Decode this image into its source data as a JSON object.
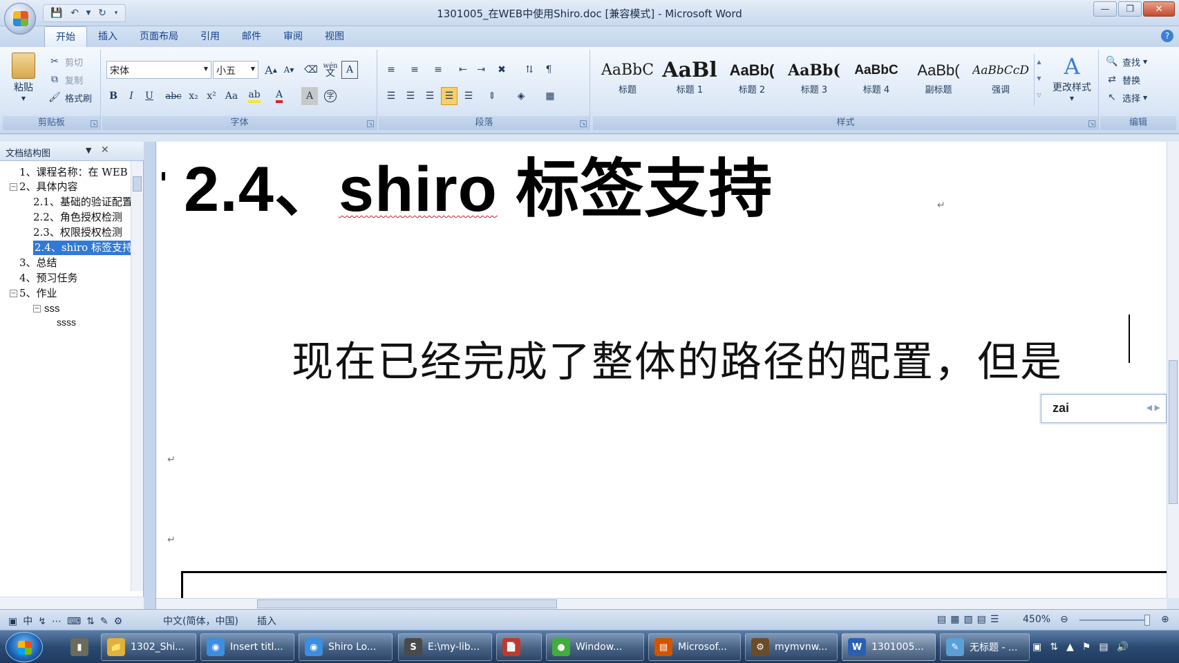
{
  "window": {
    "title": "1301005_在WEB中使用Shiro.doc [兼容模式] - Microsoft Word",
    "minimize_icon": "minimize-icon",
    "maximize_icon": "restore-icon",
    "close_icon": "close-icon"
  },
  "ribbon": {
    "tabs": [
      "开始",
      "插入",
      "页面布局",
      "引用",
      "邮件",
      "审阅",
      "视图"
    ],
    "active_tab": "开始",
    "clipboard": {
      "label": "剪贴板",
      "paste": "粘贴",
      "cut": "剪切",
      "copy": "复制",
      "format_painter": "格式刷"
    },
    "font": {
      "label": "字体",
      "family": "宋体",
      "size": "小五",
      "bold": "B",
      "italic": "I",
      "underline": "U",
      "strikethrough": "abc",
      "subscript": "x₂",
      "superscript": "x²",
      "change_case": "Aa",
      "grow": "A",
      "shrink": "A",
      "clear": "A",
      "font_color": "A",
      "char_shading": "A",
      "wen": "文",
      "phonetic": "wén"
    },
    "paragraph": {
      "label": "段落"
    },
    "styles": {
      "label": "样式",
      "items": [
        {
          "sample": "AaBbC",
          "name": "标题"
        },
        {
          "sample": "AaBl",
          "name": "标题 1"
        },
        {
          "sample": "AaBb(",
          "name": "标题 2"
        },
        {
          "sample": "AaBb(",
          "name": "标题 3"
        },
        {
          "sample": "AaBbC",
          "name": "标题 4"
        },
        {
          "sample": "AaBb(",
          "name": "副标题"
        },
        {
          "sample": "AaBbCcDi",
          "name": "强调"
        }
      ],
      "change_styles": "更改样式"
    },
    "editing": {
      "label": "编辑",
      "find": "查找",
      "replace": "替换",
      "select": "选择"
    }
  },
  "nav_pane": {
    "title": "文档结构图",
    "items": [
      {
        "text": "1、课程名称：在 WEB"
      },
      {
        "text": "2、具体内容"
      },
      {
        "text": "2.1、基础的验证配置"
      },
      {
        "text": "2.2、角色授权检测"
      },
      {
        "text": "2.3、权限授权检测"
      },
      {
        "text": "2.4、shiro 标签支持"
      },
      {
        "text": "3、总结"
      },
      {
        "text": "4、预习任务"
      },
      {
        "text": "5、作业"
      },
      {
        "text": "sss"
      },
      {
        "text": "ssss"
      }
    ]
  },
  "document": {
    "heading_prefix": "2.4、",
    "heading_word": "shiro",
    "heading_suffix": " 标签支持",
    "body": "现在已经完成了整体的路径的配置，但是",
    "ime_composition": "zai"
  },
  "statusbar": {
    "language": "中文(简体，中国)",
    "mode": "插入",
    "zoom": "450%"
  },
  "taskbar": {
    "items": [
      {
        "label": "1302_Shi...",
        "color": "#e0b23a"
      },
      {
        "label": "Insert titl...",
        "color": "#3c8ee0"
      },
      {
        "label": "Shiro Lo...",
        "color": "#3c8ee0"
      },
      {
        "label": "E:\\my-lib...",
        "color": "#4a4a4a"
      },
      {
        "label": "",
        "color": "#c0392b"
      },
      {
        "label": "Window...",
        "color": "#3fae3a"
      },
      {
        "label": "Microsof...",
        "color": "#d35400"
      },
      {
        "label": "mymvnw...",
        "color": "#6b4c2a"
      },
      {
        "label": "1301005...",
        "color": "#2b5fb4"
      },
      {
        "label": "无标题 - ...",
        "color": "#5aa0d6"
      }
    ]
  }
}
